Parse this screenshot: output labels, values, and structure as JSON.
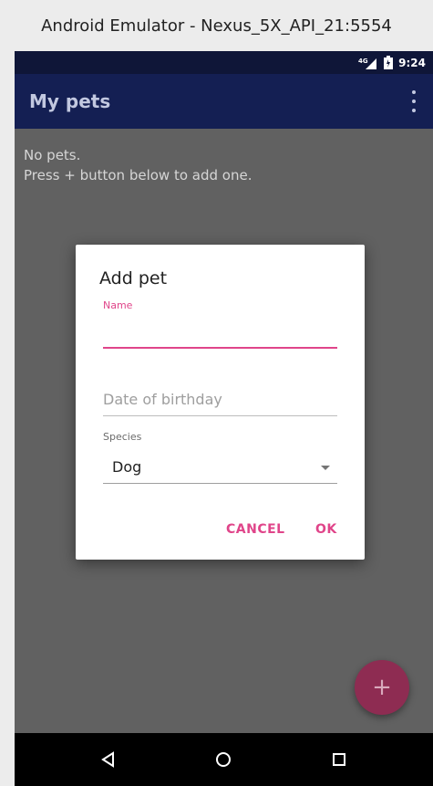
{
  "window": {
    "title": "Android Emulator - Nexus_5X_API_21:5554"
  },
  "status_bar": {
    "network": "4G",
    "time": "9:24"
  },
  "app_bar": {
    "title": "My pets",
    "menu_icon": "overflow-menu-icon"
  },
  "empty_state": {
    "line1": "No pets.",
    "line2": "Press + button below to add one."
  },
  "dialog": {
    "title": "Add pet",
    "name": {
      "label": "Name",
      "value": ""
    },
    "birthday": {
      "placeholder": "Date of birthday",
      "value": ""
    },
    "species": {
      "label": "Species",
      "selected": "Dog"
    },
    "buttons": {
      "cancel": "CANCEL",
      "ok": "OK"
    }
  },
  "fab": {
    "label": "+"
  },
  "colors": {
    "status_bar": "#0f1638",
    "app_bar": "#141f53",
    "accent": "#e0458a",
    "fab": "#8e2c52",
    "scrim_background": "#616161"
  },
  "nav_bar": {
    "icons": [
      "back-icon",
      "home-icon",
      "recents-icon"
    ]
  }
}
